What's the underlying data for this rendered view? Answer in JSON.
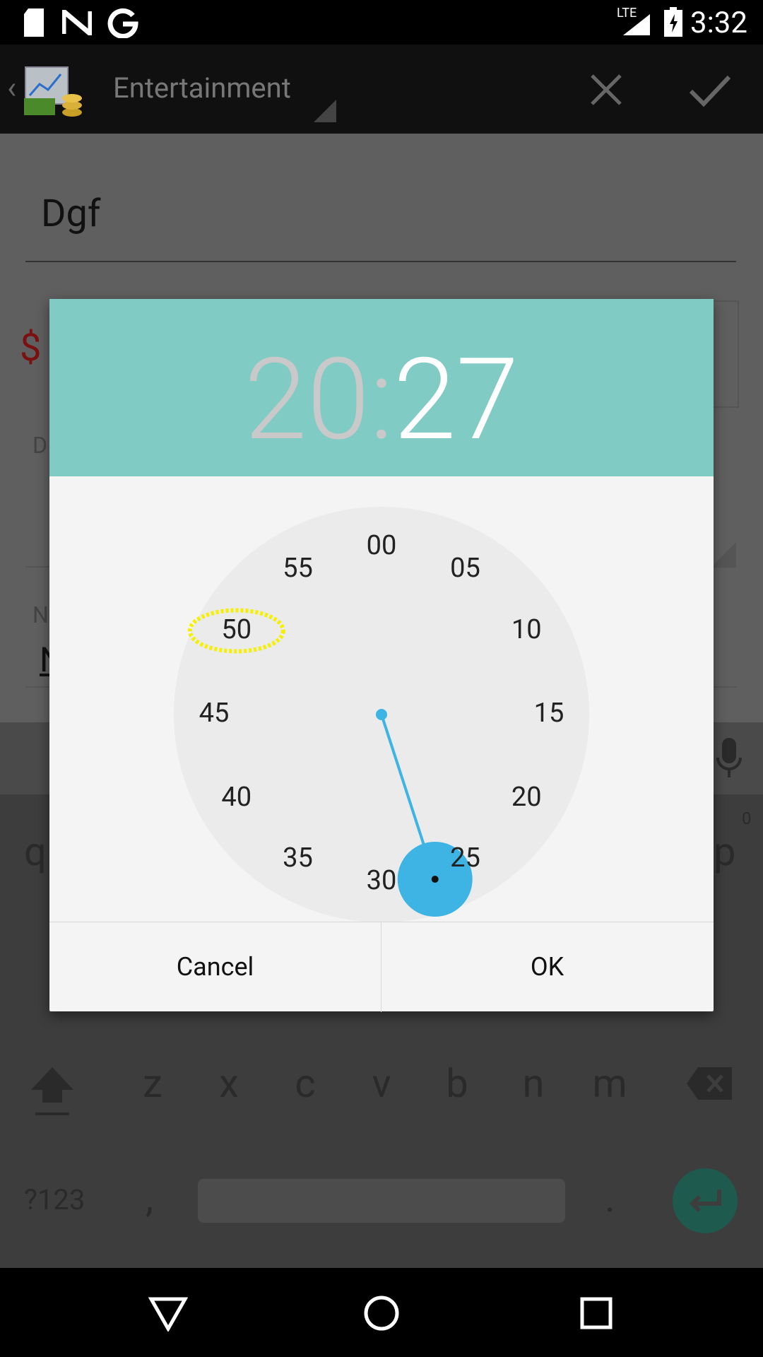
{
  "status_bar": {
    "time": "3:32",
    "network": "LTE"
  },
  "action_bar": {
    "title": "Entertainment"
  },
  "background_form": {
    "name_value": "Dgf",
    "amount_symbol": "$",
    "label_d": "D",
    "label_n": "N",
    "field_n_value": "N"
  },
  "keyboard": {
    "row_q_left": "q",
    "row_p_right": "p",
    "p_hint": "0",
    "row3": [
      "z",
      "x",
      "c",
      "v",
      "b",
      "n",
      "m"
    ],
    "symbols_key": "?123",
    "comma_key": ",",
    "period_key": "."
  },
  "dialog": {
    "hours": "20",
    "separator": ":",
    "minutes": "27",
    "clock_numbers": [
      "00",
      "05",
      "10",
      "15",
      "20",
      "25",
      "30",
      "35",
      "40",
      "45",
      "50",
      "55"
    ],
    "selected_minute": 27,
    "cancel_label": "Cancel",
    "ok_label": "OK"
  },
  "colors": {
    "header": "#80cbc4",
    "accent": "#3db4e4",
    "highlight_ring": "#f4f000"
  }
}
